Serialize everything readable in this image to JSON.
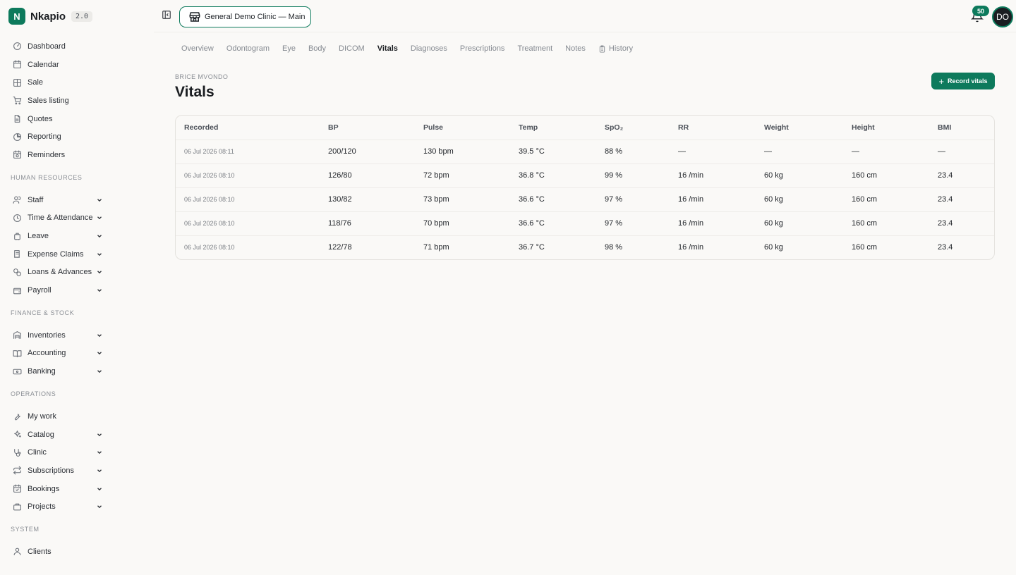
{
  "brand": {
    "name": "Nkapio",
    "version": "2.0",
    "logo_letter": "N",
    "color": "#0d7a5c"
  },
  "sidebar": {
    "items": [
      {
        "label": "Dashboard",
        "icon": "dashboard-icon"
      },
      {
        "label": "Calendar",
        "icon": "calendar-icon"
      },
      {
        "label": "Sale",
        "icon": "pos-icon"
      },
      {
        "label": "Sales listing",
        "icon": "cart-icon"
      },
      {
        "label": "Quotes",
        "icon": "document-icon"
      },
      {
        "label": "Reporting",
        "icon": "pie-chart-icon"
      },
      {
        "label": "Reminders",
        "icon": "calendar-clock-icon"
      }
    ],
    "sections": [
      {
        "label": "HUMAN RESOURCES",
        "items": [
          {
            "label": "Staff",
            "icon": "users-icon"
          },
          {
            "label": "Time & Attendance",
            "icon": "clock-icon"
          },
          {
            "label": "Leave",
            "icon": "luggage-icon"
          },
          {
            "label": "Expense Claims",
            "icon": "receipt-icon"
          },
          {
            "label": "Loans & Advances",
            "icon": "coins-icon"
          },
          {
            "label": "Payroll",
            "icon": "wallet-icon"
          }
        ]
      },
      {
        "label": "FINANCE & STOCK",
        "items": [
          {
            "label": "Inventories",
            "icon": "warehouse-icon"
          },
          {
            "label": "Accounting",
            "icon": "book-icon"
          },
          {
            "label": "Banking",
            "icon": "banknote-icon"
          }
        ]
      },
      {
        "label": "OPERATIONS",
        "items": [
          {
            "label": "My work",
            "icon": "wrench-icon"
          },
          {
            "label": "Catalog",
            "icon": "sparkles-icon"
          },
          {
            "label": "Clinic",
            "icon": "stethoscope-icon"
          },
          {
            "label": "Subscriptions",
            "icon": "repeat-icon"
          },
          {
            "label": "Bookings",
            "icon": "calendar-check-icon"
          },
          {
            "label": "Projects",
            "icon": "briefcase-icon"
          }
        ]
      },
      {
        "label": "SYSTEM",
        "items": [
          {
            "label": "Clients",
            "icon": "user-icon"
          }
        ]
      }
    ]
  },
  "topbar": {
    "clinic": "General Demo Clinic — Main",
    "notifications": "50",
    "avatar": "DO"
  },
  "tabs": [
    "Overview",
    "Odontogram",
    "Eye",
    "Body",
    "DICOM",
    "Vitals",
    "Diagnoses",
    "Prescriptions",
    "Treatment",
    "Notes",
    "History"
  ],
  "active_tab": "Vitals",
  "page": {
    "patient": "BRICE MVONDO",
    "title": "Vitals",
    "record_button": "Record vitals"
  },
  "table": {
    "columns": [
      "Recorded",
      "BP",
      "Pulse",
      "Temp",
      "SpO₂",
      "RR",
      "Weight",
      "Height",
      "BMI"
    ],
    "rows": [
      [
        "06 Jul 2026 08:11",
        "200/120",
        "130 bpm",
        "39.5 °C",
        "88 %",
        "—",
        "—",
        "—",
        "—"
      ],
      [
        "06 Jul 2026 08:10",
        "126/80",
        "72 bpm",
        "36.8 °C",
        "99 %",
        "16 /min",
        "60 kg",
        "160 cm",
        "23.4"
      ],
      [
        "06 Jul 2026 08:10",
        "130/82",
        "73 bpm",
        "36.6 °C",
        "97 %",
        "16 /min",
        "60 kg",
        "160 cm",
        "23.4"
      ],
      [
        "06 Jul 2026 08:10",
        "118/76",
        "70 bpm",
        "36.6 °C",
        "97 %",
        "16 /min",
        "60 kg",
        "160 cm",
        "23.4"
      ],
      [
        "06 Jul 2026 08:10",
        "122/78",
        "71 bpm",
        "36.7 °C",
        "98 %",
        "16 /min",
        "60 kg",
        "160 cm",
        "23.4"
      ]
    ]
  }
}
